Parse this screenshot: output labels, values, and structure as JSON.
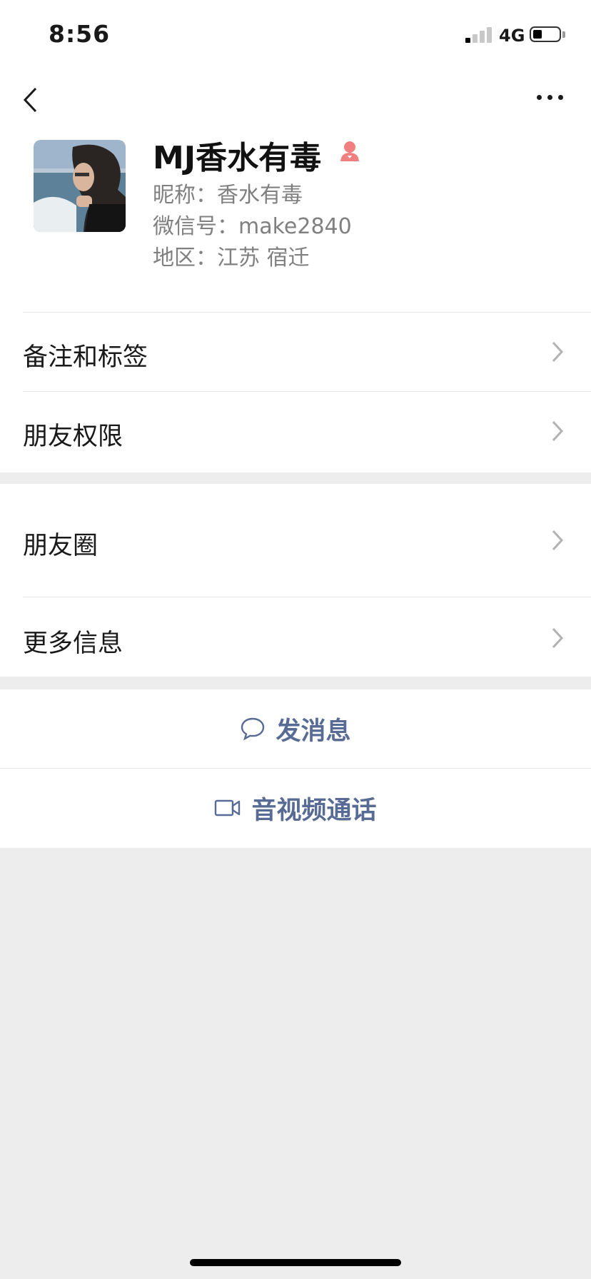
{
  "status_bar": {
    "time": "8:56",
    "network": "4G"
  },
  "profile": {
    "name": "MJ香水有毒",
    "nickname": "昵称：香水有毒",
    "wechat_id": "微信号：make2840",
    "region": "地区：江苏 宿迁",
    "gender_icon_color": "#f08080"
  },
  "menu": {
    "remark_tags": "备注和标签",
    "friend_permissions": "朋友权限",
    "moments": "朋友圈",
    "more_info": "更多信息"
  },
  "actions": {
    "send_message": "发消息",
    "video_call": "音视频通话"
  },
  "colors": {
    "link": "#576b95",
    "background": "#ededed"
  }
}
